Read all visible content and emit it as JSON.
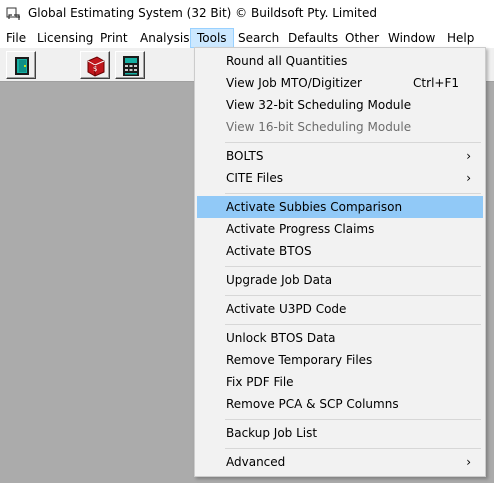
{
  "window": {
    "title": "Global Estimating System (32 Bit) © Buildsoft Pty. Limited"
  },
  "menubar": {
    "items": [
      "File",
      "Licensing",
      "Print",
      "Analysis",
      "Tools",
      "Search",
      "Defaults",
      "Other",
      "Window",
      "Help"
    ],
    "active": "Tools"
  },
  "toolbar": {
    "buttons": [
      "exit-door-icon",
      "help-book-icon",
      "calculator-icon"
    ]
  },
  "tools_menu": {
    "items": [
      {
        "label": "Round all Quantities",
        "enabled": true
      },
      {
        "label": "View Job MTO/Digitizer",
        "shortcut": "Ctrl+F1",
        "enabled": true
      },
      {
        "label": "View 32-bit Scheduling Module",
        "enabled": true
      },
      {
        "label": "View 16-bit Scheduling Module",
        "enabled": false
      },
      {
        "label": "BOLTS",
        "submenu": true,
        "enabled": true
      },
      {
        "label": "CITE Files",
        "submenu": true,
        "enabled": true
      },
      {
        "label": "Activate Subbies Comparison",
        "enabled": true,
        "highlighted": true
      },
      {
        "label": "Activate Progress Claims",
        "enabled": true
      },
      {
        "label": "Activate BTOS",
        "enabled": true
      },
      {
        "label": "Upgrade Job Data",
        "enabled": true
      },
      {
        "label": "Activate U3PD Code",
        "enabled": true
      },
      {
        "label": "Unlock BTOS Data",
        "enabled": true
      },
      {
        "label": "Remove Temporary Files",
        "enabled": true
      },
      {
        "label": "Fix PDF File",
        "enabled": true
      },
      {
        "label": "Remove PCA & SCP Columns",
        "enabled": true
      },
      {
        "label": "Backup Job List",
        "enabled": true
      },
      {
        "label": "Advanced",
        "submenu": true,
        "enabled": true
      }
    ],
    "submenu_arrow": "›"
  },
  "colors": {
    "highlight": "#91c9f7",
    "menu_bg": "#f2f2f2",
    "workspace_bg": "#ababab",
    "disabled_text": "#6d6d6d"
  }
}
